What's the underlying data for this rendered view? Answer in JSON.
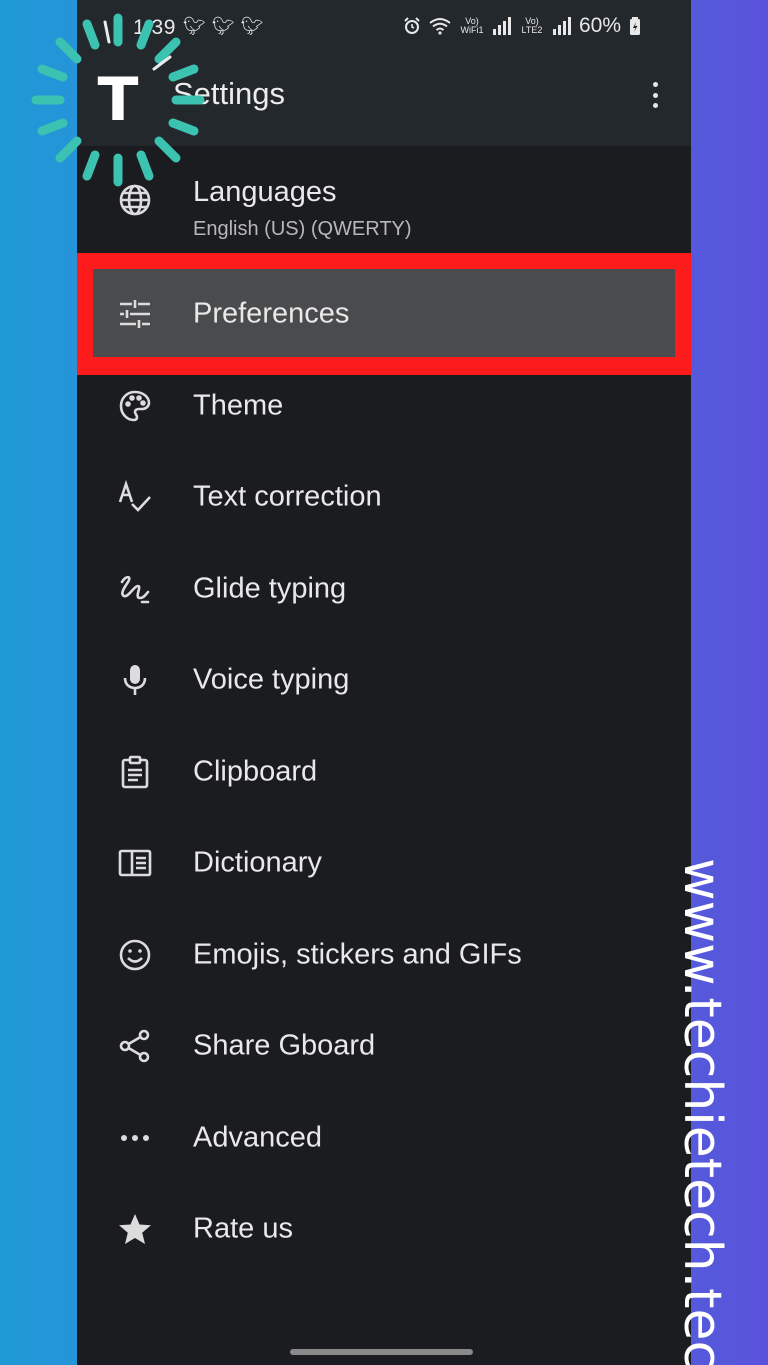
{
  "status_bar": {
    "time": "1:39",
    "battery": "60%",
    "network_labels": [
      "Vo) WiFi1",
      "Vo) LTE2"
    ]
  },
  "app_bar": {
    "title": "Settings"
  },
  "menu": [
    {
      "label": "Languages",
      "subtitle": "English (US) (QWERTY)",
      "icon": "globe-icon"
    },
    {
      "label": "Preferences",
      "icon": "sliders-icon",
      "highlighted": true
    },
    {
      "label": "Theme",
      "icon": "palette-icon"
    },
    {
      "label": "Text correction",
      "icon": "spellcheck-icon"
    },
    {
      "label": "Glide typing",
      "icon": "gesture-icon"
    },
    {
      "label": "Voice typing",
      "icon": "mic-icon"
    },
    {
      "label": "Clipboard",
      "icon": "clipboard-icon"
    },
    {
      "label": "Dictionary",
      "icon": "dictionary-icon"
    },
    {
      "label": "Emojis, stickers and GIFs",
      "icon": "emoji-icon"
    },
    {
      "label": "Share Gboard",
      "icon": "share-icon"
    },
    {
      "label": "Advanced",
      "icon": "more-horiz-icon"
    },
    {
      "label": "Rate us",
      "icon": "star-icon"
    }
  ],
  "logo": {
    "letter": "T"
  },
  "watermark": "www.techietech.tech",
  "colors": {
    "highlight_border": "#fe1b1b",
    "highlight_fill": "#4a4b4d",
    "background": "#1b1c20",
    "app_bar": "#23282d",
    "logo_teal": "#3cc2b0"
  }
}
